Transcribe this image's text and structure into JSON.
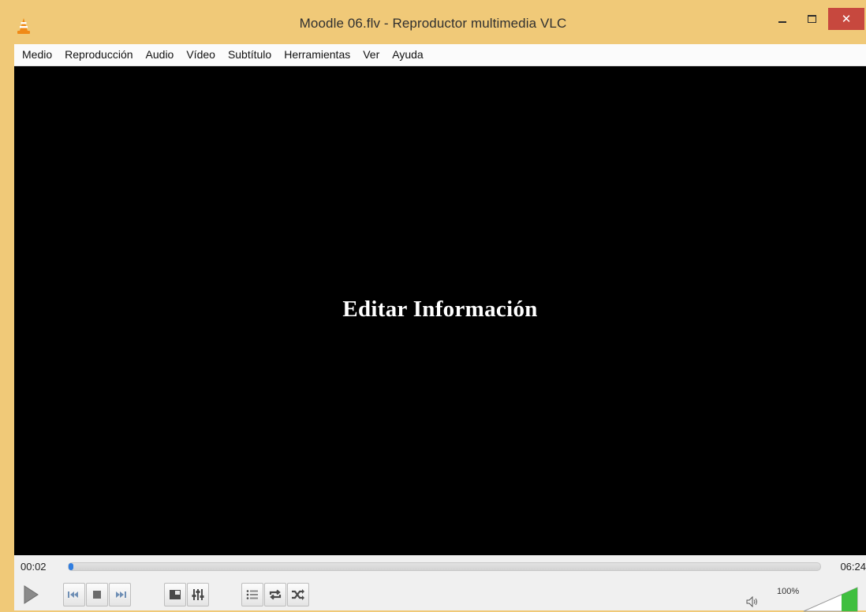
{
  "window": {
    "title": "Moodle 06.flv - Reproductor multimedia VLC",
    "close_glyph": "✕"
  },
  "menu": [
    {
      "label": "Medio"
    },
    {
      "label": "Reproducción"
    },
    {
      "label": "Audio"
    },
    {
      "label": "Vídeo"
    },
    {
      "label": "Subtítulo"
    },
    {
      "label": "Herramientas"
    },
    {
      "label": "Ver"
    },
    {
      "label": "Ayuda"
    }
  ],
  "video": {
    "overlay_text": "Editar Información"
  },
  "playback": {
    "current_time": "00:02",
    "total_time": "06:24",
    "progress_fraction": 0.005
  },
  "volume": {
    "label": "100%",
    "level_fraction": 1.0
  },
  "icons": {
    "app": "vlc-cone-icon",
    "play": "play-icon",
    "previous": "previous-icon",
    "stop": "stop-icon",
    "next": "next-icon",
    "fullscreen": "fullscreen-icon",
    "extended": "extended-settings-icon",
    "playlist": "playlist-icon",
    "loop": "loop-icon",
    "shuffle": "shuffle-icon",
    "speaker": "speaker-icon"
  },
  "colors": {
    "frame": "#f0c978",
    "seek_fill": "#2f7de0",
    "volume_fill": "#3fbf3f",
    "close_button": "#c7483e"
  }
}
